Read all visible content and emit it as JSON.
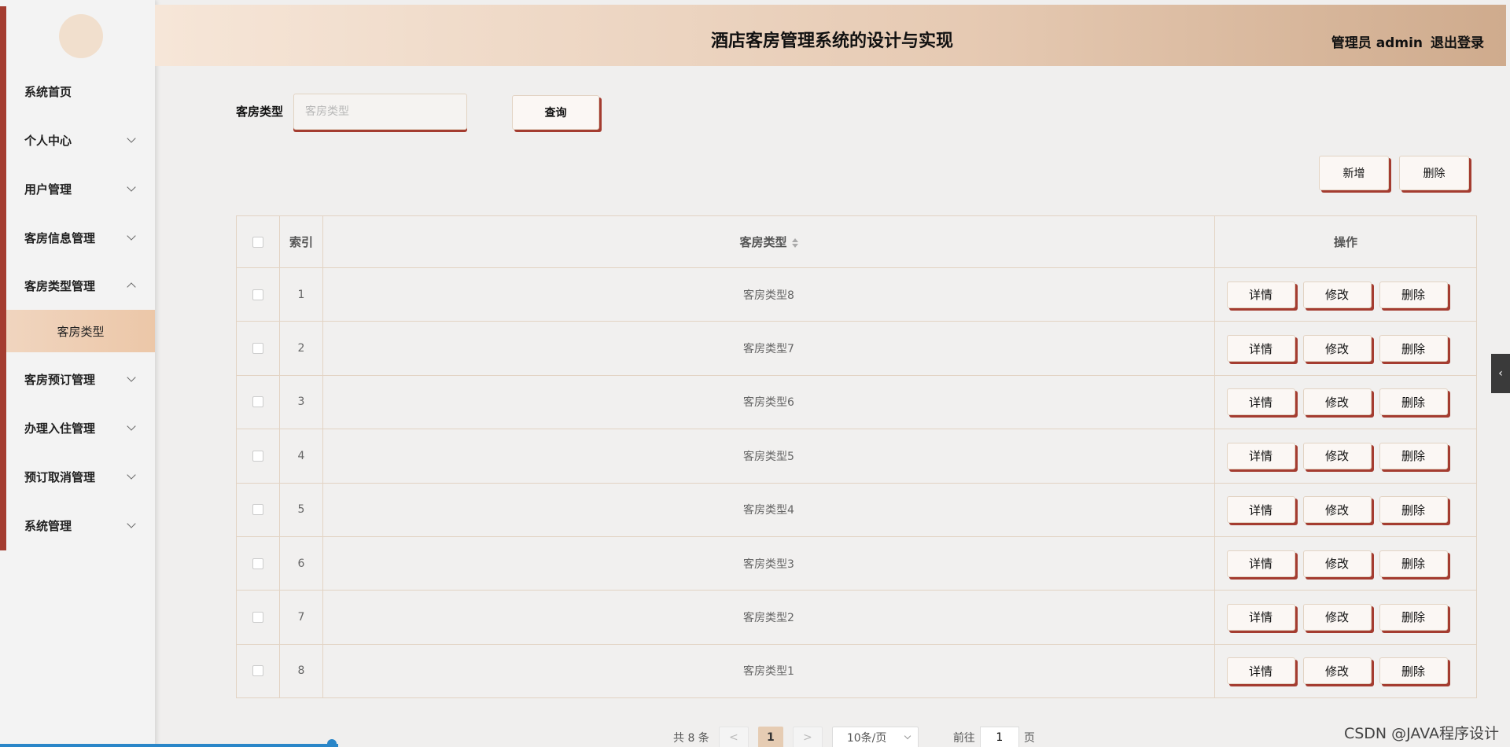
{
  "app": {
    "title": "酒店客房管理系统的设计与实现",
    "user_label": "管理员 admin",
    "logout_label": "退出登录"
  },
  "sidebar": {
    "items": [
      {
        "label": "系统首页",
        "expandable": false
      },
      {
        "label": "个人中心",
        "expandable": true
      },
      {
        "label": "用户管理",
        "expandable": true
      },
      {
        "label": "客房信息管理",
        "expandable": true
      },
      {
        "label": "客房类型管理",
        "expandable": true,
        "expanded": true
      },
      {
        "label": "客房预订管理",
        "expandable": true
      },
      {
        "label": "办理入住管理",
        "expandable": true
      },
      {
        "label": "预订取消管理",
        "expandable": true
      },
      {
        "label": "系统管理",
        "expandable": true
      }
    ],
    "active_sub_item": "客房类型"
  },
  "search": {
    "label": "客房类型",
    "placeholder": "客房类型",
    "value": "",
    "button_label": "查询"
  },
  "toolbar": {
    "add_label": "新增",
    "delete_label": "删除"
  },
  "table": {
    "columns": [
      "索引",
      "客房类型",
      "操作"
    ],
    "rows": [
      {
        "index": "1",
        "type": "客房类型8"
      },
      {
        "index": "2",
        "type": "客房类型7"
      },
      {
        "index": "3",
        "type": "客房类型6"
      },
      {
        "index": "4",
        "type": "客房类型5"
      },
      {
        "index": "5",
        "type": "客房类型4"
      },
      {
        "index": "6",
        "type": "客房类型3"
      },
      {
        "index": "7",
        "type": "客房类型2"
      },
      {
        "index": "8",
        "type": "客房类型1"
      }
    ],
    "row_actions": {
      "detail": "详情",
      "edit": "修改",
      "delete": "删除"
    }
  },
  "pagination": {
    "total_text": "共 8 条",
    "prev": "<",
    "current_page": "1",
    "next": ">",
    "page_size": "10条/页",
    "jump_prefix": "前往",
    "jump_value": "1",
    "jump_suffix": "页"
  },
  "watermark": "CSDN @JAVA程序设计",
  "colors": {
    "accent": "#a43c30",
    "header_start": "#f6e6d8",
    "header_end": "#cfab8d",
    "active_sub": "#ecc7a8"
  },
  "icons": {
    "collapse_tab": "chevron-left-icon"
  }
}
